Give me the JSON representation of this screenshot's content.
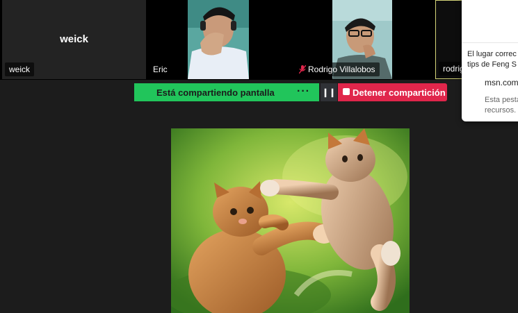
{
  "participants": [
    {
      "name": "weick",
      "big_name": "weick"
    },
    {
      "name": "Eric"
    },
    {
      "name": "Rodrigo Villalobos",
      "muted": true
    },
    {
      "name": "rodrig"
    }
  ],
  "share_bar": {
    "status_label": "Está compartiendo pantalla",
    "more_label": "···",
    "pause_label": "❙❙",
    "stop_label": "Detener compartición",
    "colors": {
      "share": "#21c55b",
      "stop": "#e0264b"
    }
  },
  "popup": {
    "line1": "El lugar correc",
    "line2": "tips de Feng S",
    "site": "msn.com",
    "desc1": "Esta pesta",
    "desc2": "recursos."
  },
  "image": {
    "description_icon": "kittens-image"
  }
}
